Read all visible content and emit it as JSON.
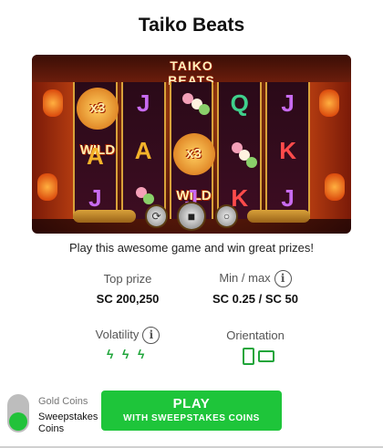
{
  "game": {
    "title": "Taiko Beats",
    "banner_logo": "TAIKO BEATS",
    "wild_label": "x3 WILD",
    "tagline": "Play this awesome game and win great prizes!"
  },
  "stats": {
    "top_prize_label": "Top prize",
    "top_prize_value": "SC 200,250",
    "minmax_label": "Min / max",
    "minmax_value": "SC 0.25 / SC 50",
    "volatility_label": "Volatility",
    "volatility_level": 3,
    "orientation_label": "Orientation"
  },
  "currency_toggle": {
    "gold_label": "Gold Coins",
    "sweep_label": "Sweepstakes Coins",
    "selected": "sweepstakes"
  },
  "play_button": {
    "line1": "PLAY",
    "line2": "WITH SWEEPSTAKES COINS"
  },
  "icons": {
    "info": "info-icon",
    "volatility": "lightning-bolt-icon",
    "portrait": "phone-portrait-icon",
    "landscape": "phone-landscape-icon"
  },
  "colors": {
    "accent": "#1ec53a",
    "toggle_off": "#bdbdbd"
  }
}
